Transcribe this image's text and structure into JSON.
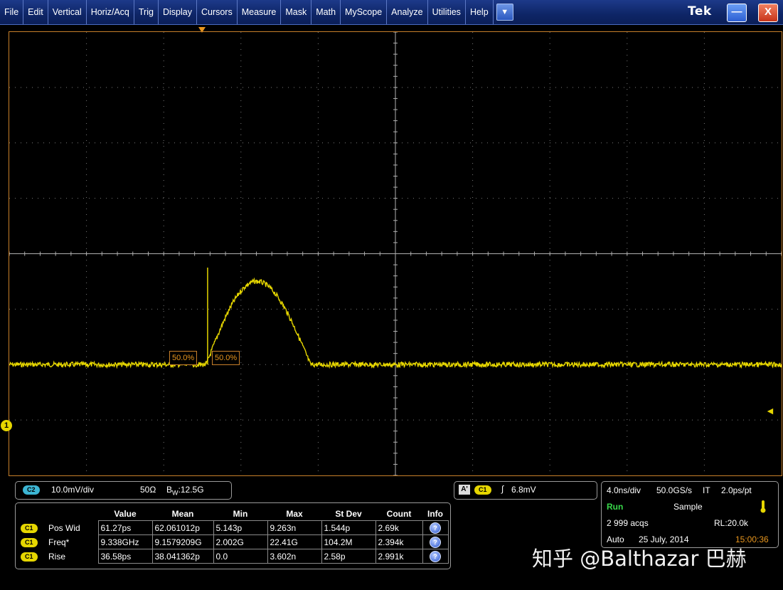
{
  "menu": {
    "items": [
      "File",
      "Edit",
      "Vertical",
      "Horiz/Acq",
      "Trig",
      "Display",
      "Cursors",
      "Measure",
      "Mask",
      "Math",
      "MyScope",
      "Analyze",
      "Utilities",
      "Help"
    ],
    "dropdown_glyph": "▼",
    "brand": "Tek",
    "minimize_glyph": "—",
    "close_glyph": "X"
  },
  "display": {
    "colors": {
      "trace": "#e6d600",
      "grid": "#7a7a7a",
      "axis": "#b0b0b0",
      "frame": "#c8802a"
    },
    "channel_marker": "1",
    "trigger_level_glyph": "◄",
    "measure_labels": [
      "50.0%",
      "50.0%"
    ],
    "waveform": {
      "time_div_ns": 4.0,
      "volts_div_mv": 10.0,
      "baseline_div": 0.0,
      "pulse_start_div": 2.55,
      "pulse_peak_div": 1.5,
      "pulse_peak_time_div": 3.2,
      "pulse_end_div": 3.9,
      "spike_div": 1.75
    }
  },
  "ch2": {
    "badge": "C2",
    "scale": "10.0mV/div",
    "impedance": "50Ω",
    "bw_prefix": "B",
    "bw_sub": "W",
    "bw_value": ":12.5G"
  },
  "trigger": {
    "mode_badge": "A'",
    "source_badge": "C1",
    "slope_glyph": "∫",
    "level": "6.8mV"
  },
  "horizontal": {
    "time_div": "4.0ns/div",
    "sample_rate": "50.0GS/s",
    "mode": "IT",
    "resolution": "2.0ps/pt",
    "status": "Run",
    "acq_mode": "Sample",
    "acqs": "2 999 acqs",
    "record_length": "RL:20.0k",
    "trig_mode": "Auto",
    "date": "25 July, 2014",
    "time": "15:00:36",
    "status_color": "#38d84a",
    "time_color": "#e8961e"
  },
  "measurements": {
    "headers": [
      "Value",
      "Mean",
      "Min",
      "Max",
      "St Dev",
      "Count",
      "Info"
    ],
    "rows": [
      {
        "source": "C1",
        "name": "Pos Wid",
        "value": "61.27ps",
        "mean": "62.061012p",
        "min": "5.143p",
        "max": "9.263n",
        "stdev": "1.544p",
        "count": "2.69k"
      },
      {
        "source": "C1",
        "name": "Freq*",
        "value": "9.338GHz",
        "mean": "9.1579209G",
        "min": "2.002G",
        "max": "22.41G",
        "stdev": "104.2M",
        "count": "2.394k"
      },
      {
        "source": "C1",
        "name": "Rise",
        "value": "36.58ps",
        "mean": "38.041362p",
        "min": "0.0",
        "max": "3.602n",
        "stdev": "2.58p",
        "count": "2.991k"
      }
    ],
    "info_glyph": "?"
  },
  "watermark": "知乎 @Balthazar 巴赫"
}
